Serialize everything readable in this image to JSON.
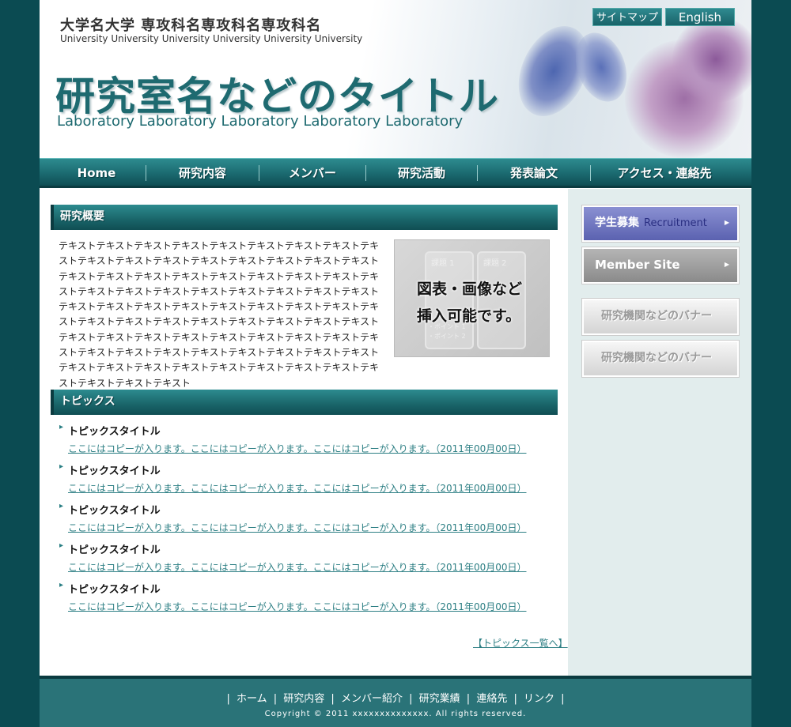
{
  "header": {
    "univ_jp": "大学名大学 専攻科名専攻科名専攻科名",
    "univ_en": "University University University University University University",
    "title": "研究室名などのタイトル",
    "title_en": "Laboratory Laboratory Laboratory Laboratory Laboratory",
    "sitemap_label": "サイトマップ",
    "english_label": "English"
  },
  "nav": {
    "items": [
      {
        "label": "Home"
      },
      {
        "label": "研究内容"
      },
      {
        "label": "メンバー"
      },
      {
        "label": "研究活動"
      },
      {
        "label": "発表論文"
      },
      {
        "label": "アクセス・連絡先"
      }
    ]
  },
  "overview": {
    "heading": "研究概要",
    "text": "テキストテキストテキストテキストテキストテキストテキストテキストテキストテキストテキストテキストテキストテキストテキストテキストテキストテキストテキストテキストテキストテキストテキストテキストテキストテキストテキストテキストテキストテキストテキストテキストテキストテキストテキストテキストテキストテキストテキストテキストテキストテキストテキストテキストテキストテキストテキストテキストテキストテキストテキストテキストテキストテキストテキストテキストテキストテキストテキストテキストテキストテキストテキストテキストテキストテキストテキストテキストテキストテキストテキストテキストテキストテキストテキストテキストテキストテキストテキストテキスト",
    "figure": {
      "label_left": "課題 1",
      "label_right": "課題 2",
      "point1": "・ポイント 1",
      "point2": "・ポイント 2",
      "caption_line1": "図表・画像など",
      "caption_line2": "挿入可能です。"
    }
  },
  "topics": {
    "heading": "トピックス",
    "items": [
      {
        "title": "トピックスタイトル",
        "text": "ここにはコピーが入ります。ここにはコピーが入ります。ここにはコピーが入ります。（2011年00月00日）"
      },
      {
        "title": "トピックスタイトル",
        "text": "ここにはコピーが入ります。ここにはコピーが入ります。ここにはコピーが入ります。（2011年00月00日）"
      },
      {
        "title": "トピックスタイトル",
        "text": "ここにはコピーが入ります。ここにはコピーが入ります。ここにはコピーが入ります。（2011年00月00日）"
      },
      {
        "title": "トピックスタイトル",
        "text": "ここにはコピーが入ります。ここにはコピーが入ります。ここにはコピーが入ります。（2011年00月00日）"
      },
      {
        "title": "トピックスタイトル",
        "text": "ここにはコピーが入ります。ここにはコピーが入ります。ここにはコピーが入ります。（2011年00月00日）"
      }
    ],
    "more_label": "【トピックス一覧へ】"
  },
  "sidebar": {
    "recruit_label": "学生募集",
    "recruit_sub": "Recruitment",
    "member_label": "Member Site",
    "banner1": "研究機関などのバナー",
    "banner2": "研究機関などのバナー"
  },
  "footer": {
    "links": [
      "ホーム",
      "研究内容",
      "メンバー紹介",
      "研究業績",
      "連絡先",
      "リンク"
    ],
    "copyright": "Copyright © 2011 xxxxxxxxxxxxxx. All rights reserved."
  },
  "colors": {
    "background": "#0b4b52",
    "nav_teal": "#1b6a70",
    "title_teal": "#1e6a70",
    "link_teal": "#2d7f84",
    "sidebar_bg": "#e2eded",
    "recruit_blue": "#5b62b0"
  }
}
